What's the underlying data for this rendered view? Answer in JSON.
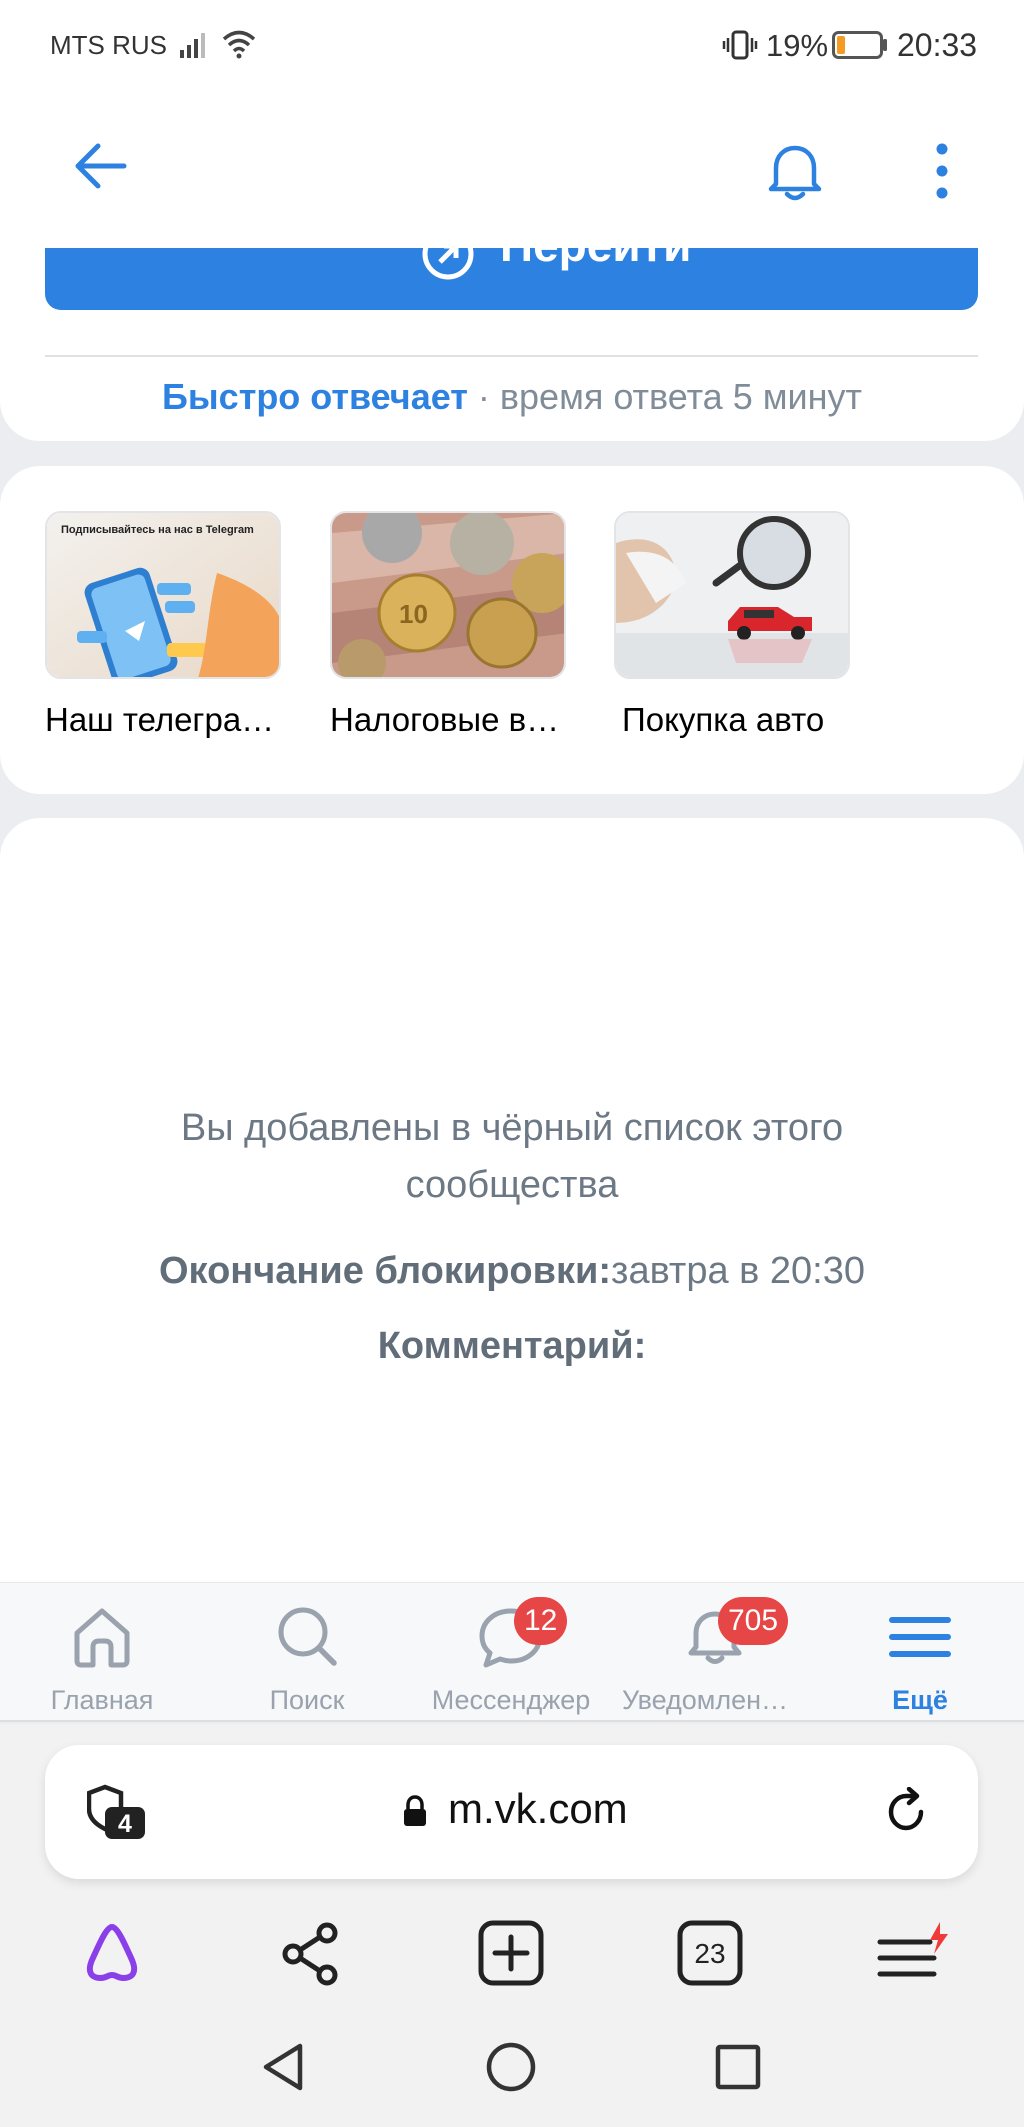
{
  "status_bar": {
    "carrier": "MTS RUS",
    "battery_percent": "19%",
    "time": "20:33",
    "battery_level": 0.19,
    "battery_color": "#f59a23"
  },
  "header": {
    "back_icon": "arrow-left-icon",
    "notifications_icon": "bell-icon",
    "more_icon": "dots-vertical-icon"
  },
  "action": {
    "go_label": "Перейти",
    "reply_fast": "Быстро отвечает",
    "reply_time": "· время ответа 5 минут"
  },
  "articles": {
    "items": [
      {
        "title": "Наш телегра…",
        "thumb_caption": "Подписывайтесь на нас в Telegram"
      },
      {
        "title": "Налоговые в…"
      },
      {
        "title": "Покупка авто"
      }
    ]
  },
  "blacklist": {
    "message_line1": "Вы добавлены в чёрный список этого",
    "message_line2": "сообщества",
    "end_label": "Окончание блокировки:",
    "end_value": "завтра в 20:30",
    "comment_label": "Комментарий:"
  },
  "tabs": [
    {
      "label": "Главная",
      "icon": "home-icon"
    },
    {
      "label": "Поиск",
      "icon": "search-icon"
    },
    {
      "label": "Мессенджер",
      "icon": "chat-icon",
      "badge": "12"
    },
    {
      "label": "Уведомлен…",
      "icon": "bell-icon",
      "badge": "705"
    },
    {
      "label": "Ещё",
      "icon": "menu-icon"
    }
  ],
  "browser": {
    "shield_count": "4",
    "url": "m.vk.com",
    "tabs_count": "23"
  },
  "colors": {
    "accent": "#2d81e0",
    "badge": "#e64646",
    "alice": "#8b3fe8"
  }
}
